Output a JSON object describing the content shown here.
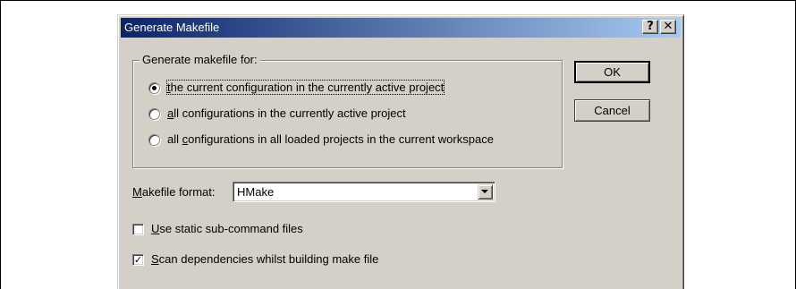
{
  "dialog": {
    "title": "Generate Makefile",
    "help_button": "?",
    "close_button": "✕"
  },
  "group": {
    "label_hotkey": "",
    "label": "Generate makefile for:"
  },
  "radios": [
    {
      "hotkey": "t",
      "rest": "he current configuration in the currently active project",
      "checked": true
    },
    {
      "hotkey": "a",
      "rest": "ll configurations in the currently active project",
      "checked": false
    },
    {
      "prefix": "all ",
      "hotkey": "c",
      "rest": "onfigurations in all loaded projects in the current workspace",
      "checked": false
    }
  ],
  "buttons": {
    "ok": "OK",
    "cancel": "Cancel"
  },
  "makefile_format": {
    "label_hotkey": "M",
    "label_rest": "akefile format:",
    "value": "HMake"
  },
  "checkboxes": [
    {
      "hotkey": "U",
      "rest": "se static sub-command files",
      "checked": false,
      "mark": ""
    },
    {
      "hotkey": "S",
      "rest": "can dependencies whilst building make file",
      "checked": true,
      "mark": "✓"
    }
  ]
}
